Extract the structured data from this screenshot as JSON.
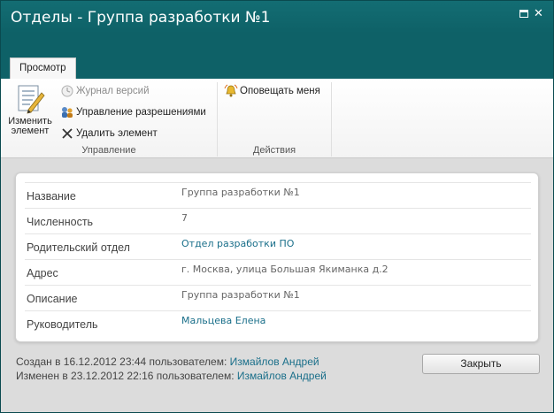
{
  "window": {
    "title": "Отделы - Группа разработки №1"
  },
  "ribbon": {
    "tab": "Просмотр",
    "edit_item": "Изменить элемент",
    "edit_item_line1": "Изменить",
    "edit_item_line2": "элемент",
    "version_history": "Журнал версий",
    "manage_permissions": "Управление разрешениями",
    "delete_item": "Удалить элемент",
    "group_manage": "Управление",
    "alert_me": "Оповещать меня",
    "group_actions": "Действия"
  },
  "fields": [
    {
      "label": "Название",
      "value": "Группа разработки №1",
      "link": false
    },
    {
      "label": "Численность",
      "value": "7",
      "link": false
    },
    {
      "label": "Родительский отдел",
      "value": "Отдел разработки ПО",
      "link": true
    },
    {
      "label": "Адрес",
      "value": "г. Москва, улица Большая Якиманка д.2",
      "link": false
    },
    {
      "label": "Описание",
      "value": "Группа разработки №1",
      "link": false
    },
    {
      "label": "Руководитель",
      "value": "Мальцева Елена",
      "link": true
    }
  ],
  "footer": {
    "created_prefix": "Создан в 16.12.2012 23:44 пользователем:",
    "created_by": "Измайлов Андрей",
    "modified_prefix": "Изменен в 23.12.2012 22:16 пользователем:",
    "modified_by": "Измайлов Андрей",
    "close_label": "Закрыть"
  },
  "colors": {
    "titlebar": "#0e6167",
    "link": "#1a6f8a"
  }
}
